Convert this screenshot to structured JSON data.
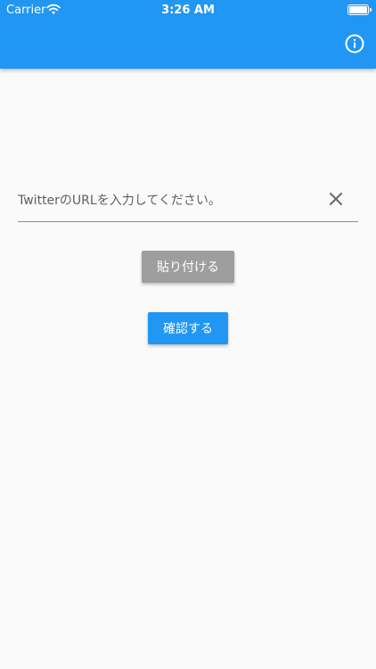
{
  "status_bar": {
    "carrier": "Carrier",
    "time": "3:26 AM",
    "wifi_icon": "wifi-icon",
    "battery_icon": "battery-icon"
  },
  "app_bar": {
    "title": "",
    "info_icon": "info-icon",
    "color": "#2196f3"
  },
  "form": {
    "url_input": {
      "value": "",
      "placeholder": "TwitterのURLを入力してください。"
    },
    "clear_icon": "close-icon",
    "paste_label": "貼り付ける",
    "confirm_label": "確認する"
  },
  "colors": {
    "accent": "#2196f3",
    "paste_button": "#9e9e9e",
    "background": "#fafafa"
  }
}
